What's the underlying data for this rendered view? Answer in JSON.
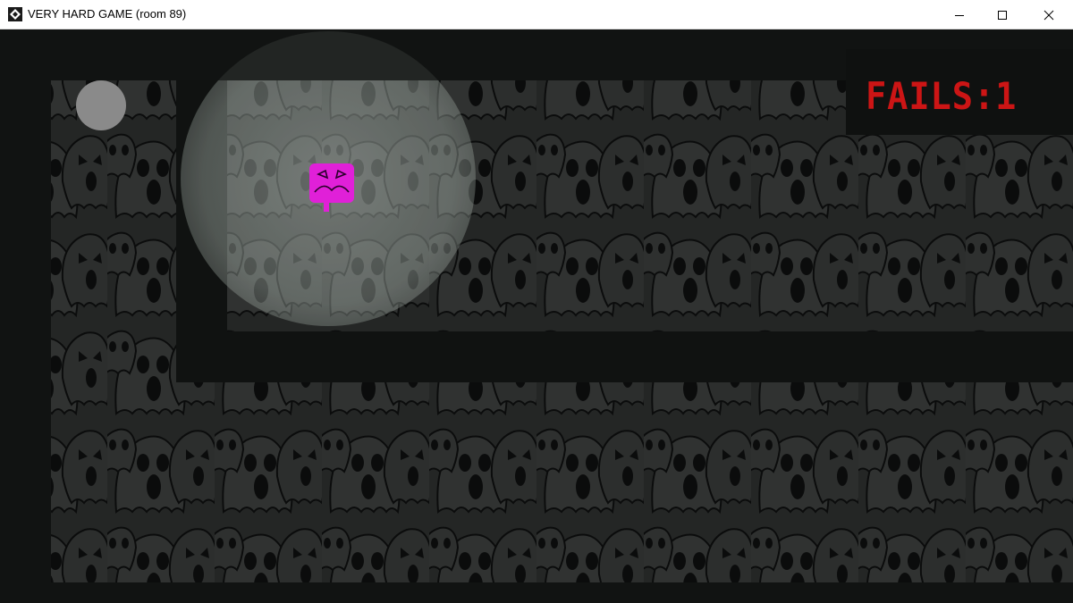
{
  "window": {
    "title": "VERY HARD GAME (room 89)",
    "icon": "game-maker-icon",
    "controls": [
      "minimize-icon",
      "maximize-icon",
      "close-icon"
    ]
  },
  "hud": {
    "fails_text": "FAILS:1",
    "fails_count": 1,
    "fails_color": "#cc1515"
  },
  "colors": {
    "background": "#111312",
    "wall": "#101211",
    "floor_pattern": "#2a2c2b",
    "player": "#e020d8",
    "goal": "#8a8a8a",
    "light_glow": "#b8c4bd"
  },
  "game": {
    "player": "magenta-square-character",
    "goal": "gray-circle",
    "floor_pattern_motif": "screaming-ghosts"
  }
}
